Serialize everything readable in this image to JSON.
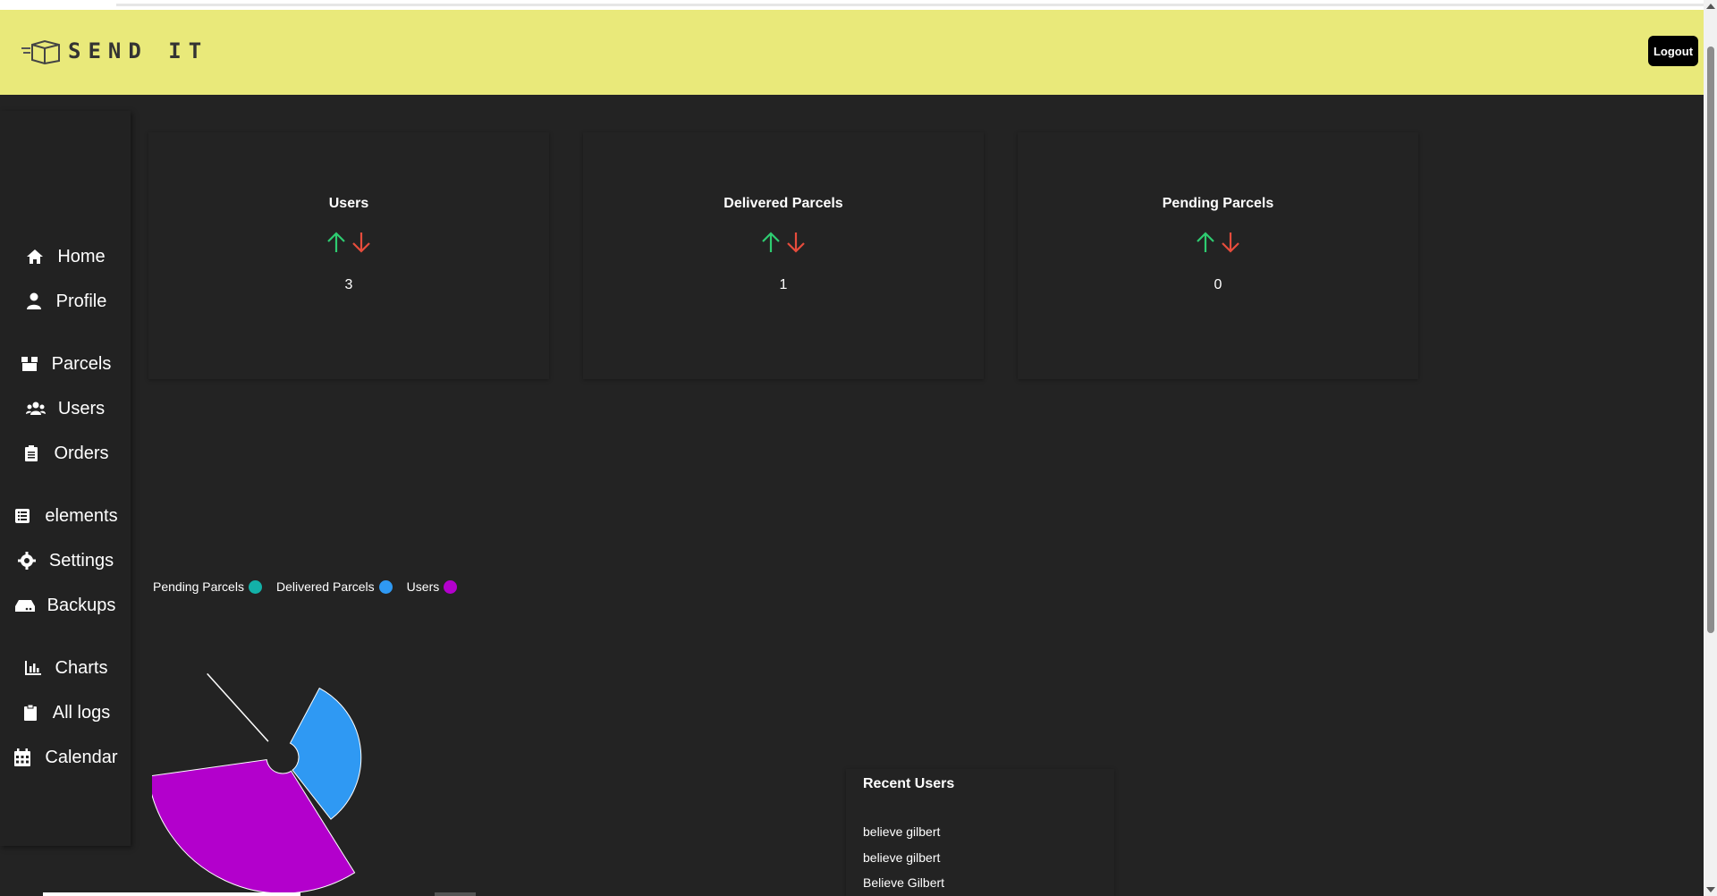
{
  "app": {
    "brand": "SEND IT",
    "logout_label": "Logout"
  },
  "sidebar": {
    "items": [
      {
        "label": "Home",
        "icon": "home-icon"
      },
      {
        "label": "Profile",
        "icon": "user-icon"
      },
      {
        "label": "Parcels",
        "icon": "box-icon"
      },
      {
        "label": "Users",
        "icon": "users-icon"
      },
      {
        "label": "Orders",
        "icon": "clipboard-icon"
      },
      {
        "label": "elements",
        "icon": "list-icon"
      },
      {
        "label": "Settings",
        "icon": "gear-icon"
      },
      {
        "label": "Backups",
        "icon": "hdd-icon"
      },
      {
        "label": "Charts",
        "icon": "bar-chart-icon"
      },
      {
        "label": "All logs",
        "icon": "clipboard-icon"
      },
      {
        "label": "Calendar",
        "icon": "calendar-icon"
      }
    ]
  },
  "stats": [
    {
      "title": "Users",
      "value": "3"
    },
    {
      "title": "Delivered Parcels",
      "value": "1"
    },
    {
      "title": "Pending Parcels",
      "value": "0"
    }
  ],
  "colors": {
    "up_arrow": "#2ecc71",
    "down_arrow": "#e74c3c",
    "header_bg": "#e9e97a",
    "body_bg": "#232323"
  },
  "chart_data": {
    "type": "pie",
    "legend": [
      "Pending Parcels",
      "Delivered Parcels",
      "Users"
    ],
    "categories": [
      "Pending Parcels",
      "Delivered Parcels",
      "Users"
    ],
    "values": [
      0,
      1,
      3
    ],
    "colors": [
      "#13b1a8",
      "#2f99f3",
      "#b300cc"
    ],
    "legend_position": "top-left"
  },
  "recent_users": {
    "title": "Recent Users",
    "items": [
      "believe gilbert",
      "believe gilbert",
      "Believe Gilbert"
    ]
  }
}
